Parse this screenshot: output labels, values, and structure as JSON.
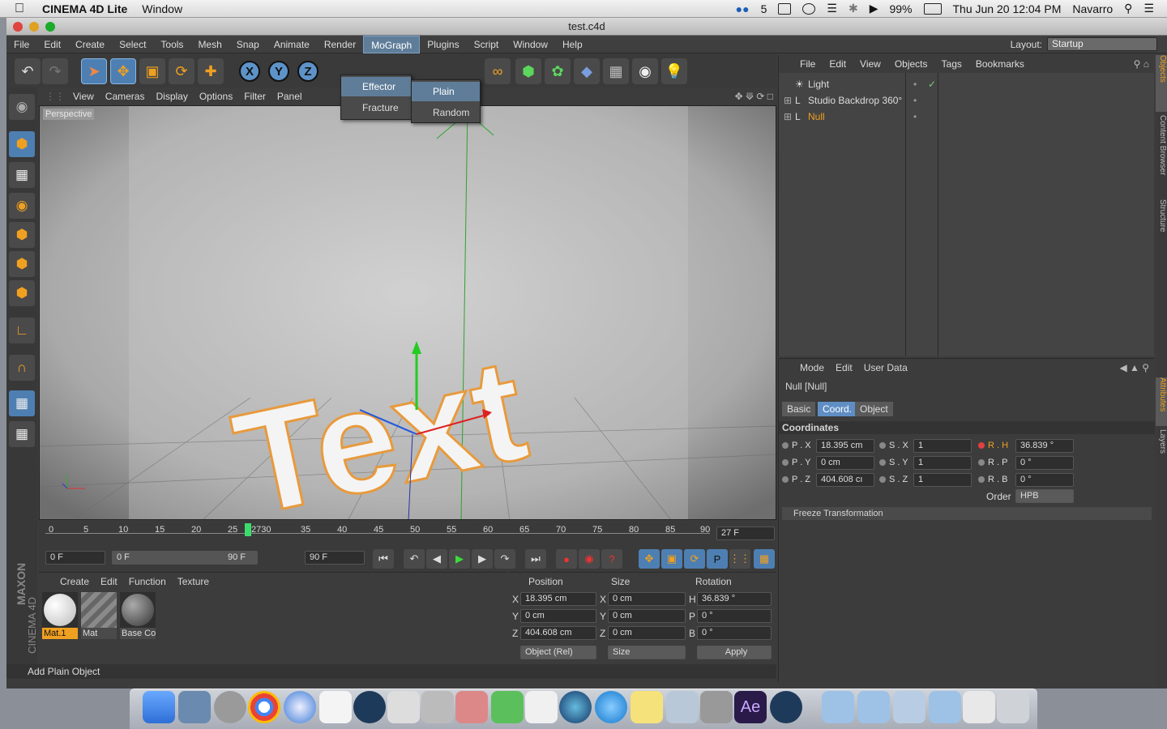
{
  "system_menu": {
    "app_name": "CINEMA 4D Lite",
    "window_menu": "Window",
    "cc_count": "5",
    "battery": "99%",
    "datetime": "Thu Jun 20  12:04 PM",
    "user": "Navarro"
  },
  "window": {
    "title": "test.c4d"
  },
  "app_menu": {
    "items": [
      "File",
      "Edit",
      "Create",
      "Select",
      "Tools",
      "Mesh",
      "Snap",
      "Animate",
      "Render",
      "MoGraph",
      "Plugins",
      "Script",
      "Window",
      "Help"
    ],
    "active": "MoGraph",
    "layout_label": "Layout:",
    "layout_value": "Startup"
  },
  "mograph_menu": {
    "items": [
      "Effector",
      "Fracture"
    ],
    "submenu": [
      "Plain",
      "Random"
    ]
  },
  "toolbar": {
    "axis_x": "X",
    "axis_y": "Y",
    "axis_z": "Z"
  },
  "viewport": {
    "menu": [
      "View",
      "Cameras",
      "Display",
      "Options",
      "Filter",
      "Panel"
    ],
    "label": "Perspective",
    "scene_text": "Text"
  },
  "timeline": {
    "ticks": [
      "0",
      "5",
      "10",
      "15",
      "20",
      "25",
      "2730",
      "35",
      "40",
      "45",
      "50",
      "55",
      "60",
      "65",
      "70",
      "75",
      "80",
      "85",
      "90"
    ],
    "current_frame": "27 F",
    "start": "0 F",
    "range_start": "0 F",
    "range_end": "90 F",
    "end": "90 F"
  },
  "material_manager": {
    "menu": [
      "Create",
      "Edit",
      "Function",
      "Texture"
    ],
    "materials": [
      "Mat.1",
      "Mat",
      "Base Co"
    ]
  },
  "coord_manager": {
    "headers": [
      "Position",
      "Size",
      "Rotation"
    ],
    "rows": [
      {
        "axis": "X",
        "pos": "18.395 cm",
        "size_axis": "X",
        "size": "0 cm",
        "rot_axis": "H",
        "rot": "36.839 °"
      },
      {
        "axis": "Y",
        "pos": "0 cm",
        "size_axis": "Y",
        "size": "0 cm",
        "rot_axis": "P",
        "rot": "0 °"
      },
      {
        "axis": "Z",
        "pos": "404.608 cm",
        "size_axis": "Z",
        "size": "0 cm",
        "rot_axis": "B",
        "rot": "0 °"
      }
    ],
    "mode": "Object (Rel)",
    "size_mode": "Size",
    "apply": "Apply"
  },
  "status": "Add Plain Object",
  "object_manager": {
    "menu": [
      "File",
      "Edit",
      "View",
      "Objects",
      "Tags",
      "Bookmarks"
    ],
    "objects": [
      {
        "name": "Light",
        "selected": false
      },
      {
        "name": "Studio Backdrop 360°",
        "selected": false
      },
      {
        "name": "Null",
        "selected": true
      }
    ]
  },
  "attribute_manager": {
    "menu": [
      "Mode",
      "Edit",
      "User Data"
    ],
    "object_title": "Null [Null]",
    "tabs": [
      "Basic",
      "Coord.",
      "Object"
    ],
    "active_tab": "Coord.",
    "section": "Coordinates",
    "rows": [
      {
        "p_label": "P . X",
        "p_val": "18.395 cm",
        "s_label": "S . X",
        "s_val": "1",
        "r_label": "R . H",
        "r_val": "36.839 °"
      },
      {
        "p_label": "P . Y",
        "p_val": "0 cm",
        "s_label": "S . Y",
        "s_val": "1",
        "r_label": "R . P",
        "r_val": "0 °"
      },
      {
        "p_label": "P . Z",
        "p_val": "404.608 cı",
        "s_label": "S . Z",
        "s_val": "1",
        "r_label": "R . B",
        "r_val": "0 °"
      }
    ],
    "order_label": "Order",
    "order_value": "HPB",
    "freeze": "Freeze Transformation"
  },
  "side_tabs": [
    "Objects",
    "Content Browser",
    "Structure",
    "Attributes",
    "Layers"
  ],
  "brand": {
    "maxon": "MAXON",
    "c4d": "CINEMA 4D"
  },
  "colors": {
    "accent": "#5f8ec4",
    "orange": "#f0a020",
    "bg": "#3c3c3c"
  }
}
